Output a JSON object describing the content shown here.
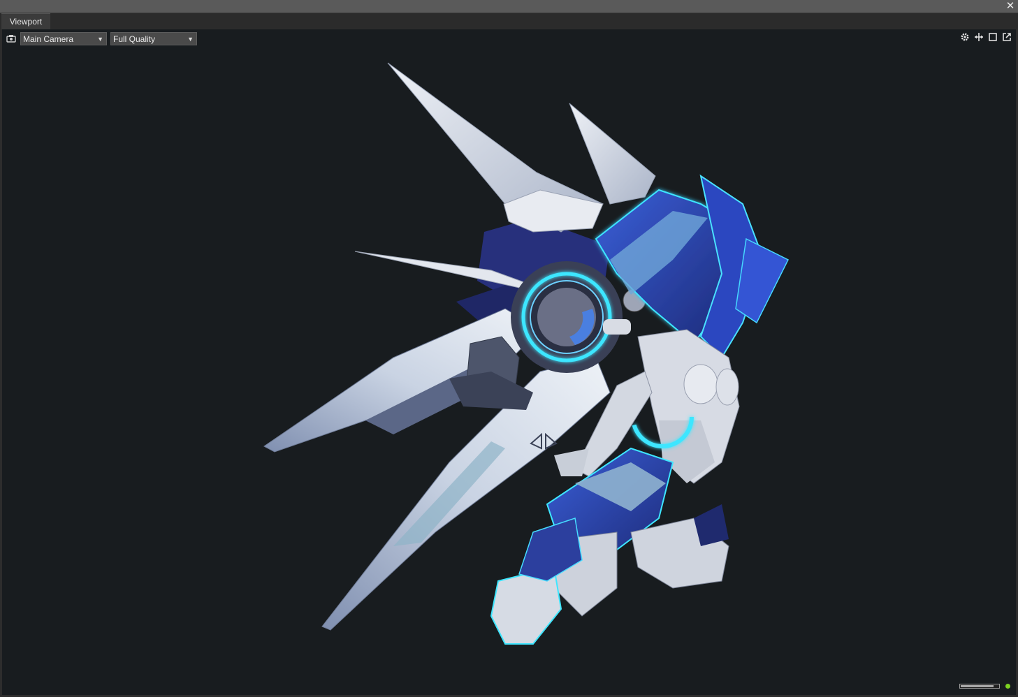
{
  "window": {
    "tab_label": "Viewport",
    "close_glyph": "✕"
  },
  "toolbar": {
    "camera_icon": "camera-icon",
    "camera_select": {
      "selected": "Main Camera"
    },
    "quality_select": {
      "selected": "Full Quality"
    },
    "dropdown_arrow": "▼",
    "right_icons": [
      "gear-icon",
      "move-icon",
      "maximize-icon",
      "popout-icon"
    ]
  },
  "status": {
    "progress": 0.88,
    "indicator_color": "#7ed321"
  },
  "colors": {
    "viewport_bg": "#181c1f",
    "armor_white": "#dfe3ea",
    "armor_blue": "#2c3f9e",
    "glow_cyan": "#3ee6ff"
  }
}
